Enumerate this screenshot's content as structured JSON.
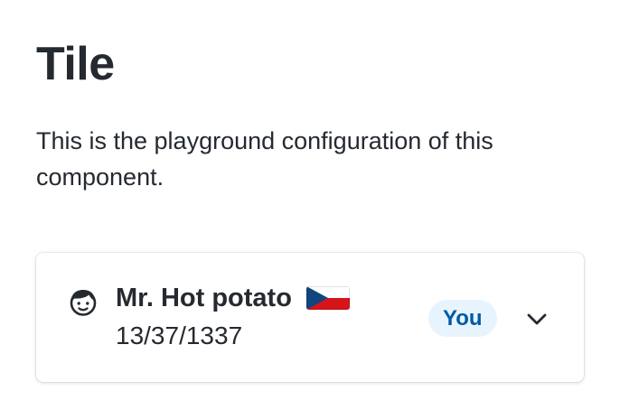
{
  "page": {
    "title": "Tile",
    "description": "This is the playground configuration of this component."
  },
  "tile": {
    "icon": "passenger-face-icon",
    "name": "Mr. Hot potato",
    "flag": "flag-cz-icon",
    "date": "13/37/1337",
    "badge": "You",
    "expand_icon": "chevron-down-icon"
  },
  "colors": {
    "text": "#252a31",
    "badge_bg": "#e8f4fd",
    "badge_text": "#005aa3",
    "flag_blue": "#11457e",
    "flag_red": "#d7141a",
    "flag_white": "#ffffff"
  }
}
